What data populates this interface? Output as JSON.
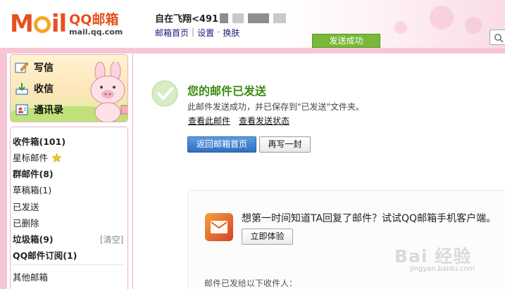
{
  "header": {
    "logo_brand": "QQ邮箱",
    "logo_domain": "mail.qq.com",
    "user_label": "自在飞翔<491",
    "links": [
      "邮箱首页",
      "设置",
      "换肤"
    ],
    "toast": "发送成功"
  },
  "sidebar": {
    "quick_actions": [
      {
        "label": "写信",
        "icon": "compose-icon"
      },
      {
        "label": "收信",
        "icon": "inbox-download-icon"
      },
      {
        "label": "通讯录",
        "icon": "contacts-icon"
      }
    ],
    "folders": [
      {
        "name": "收件箱",
        "count": "(101)",
        "bold": true
      },
      {
        "name": "星标邮件",
        "count": "",
        "bold": false,
        "star": true
      },
      {
        "name": "群邮件",
        "count": "(8)",
        "bold": true
      },
      {
        "name": "草稿箱",
        "count": "(1)",
        "bold": false
      },
      {
        "name": "已发送",
        "count": "",
        "bold": false
      },
      {
        "name": "已删除",
        "count": "",
        "bold": false
      },
      {
        "name": "垃圾箱",
        "count": "(9)",
        "bold": true,
        "clear": "[清空]"
      },
      {
        "name": "QQ邮件订阅",
        "count": "(1)",
        "bold": true
      },
      {
        "name": "其他邮箱",
        "count": "",
        "bold": false
      }
    ]
  },
  "main": {
    "title": "您的邮件已发送",
    "desc": "此邮件发送成功，并已保存到\"已发送\"文件夹。",
    "links": [
      "查看此邮件",
      "查看发送状态"
    ],
    "buttons": {
      "back": "返回邮箱首页",
      "again": "再写一封"
    },
    "promo": {
      "text": "想第一时间知道TA回复了邮件？试试QQ邮箱手机客户端。",
      "button": "立即体验"
    },
    "recipients_label": "邮件已发给以下收件人："
  },
  "watermark": {
    "text": "Bai 经验",
    "sub": "jingyan.baidu.com"
  },
  "colors": {
    "accent": "#3d8a12",
    "toast": "#79b83a",
    "frame": "#f7c6d6",
    "primary_button": "#2f6fc0"
  }
}
